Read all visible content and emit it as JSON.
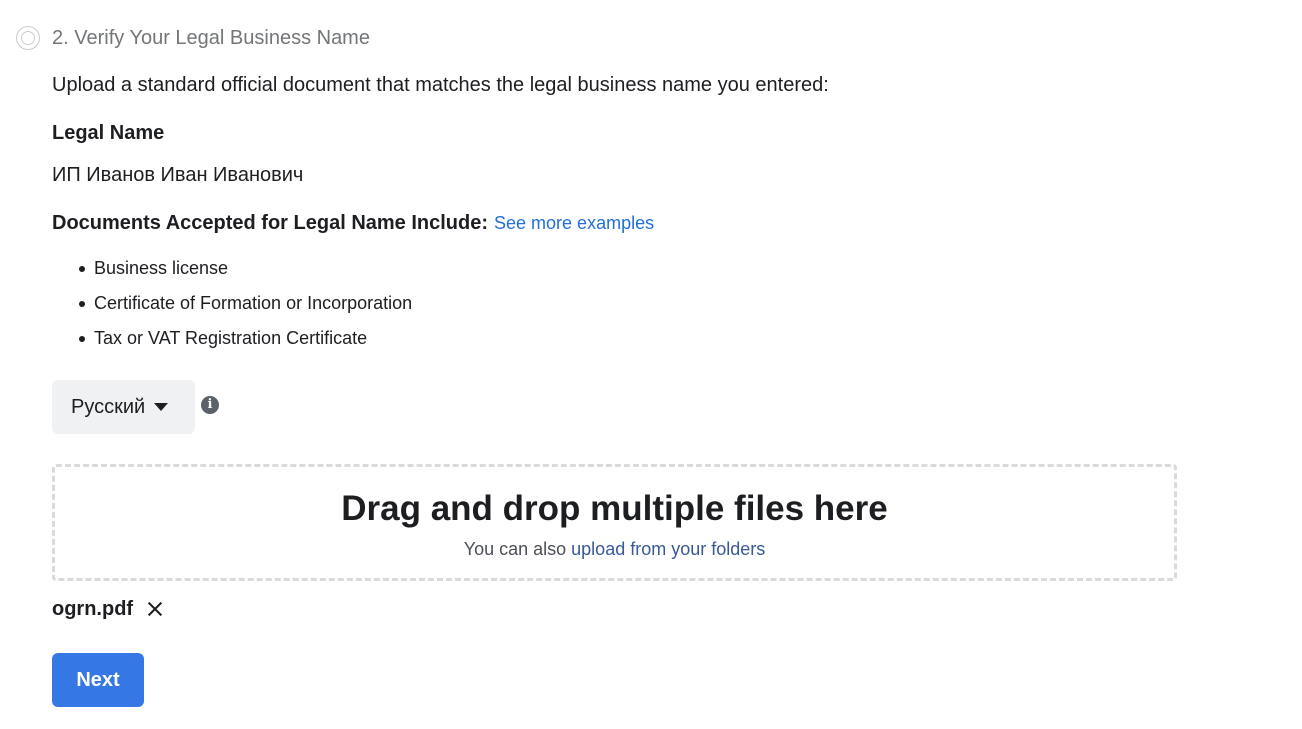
{
  "step": {
    "title": "2. Verify Your Legal Business Name"
  },
  "intro": "Upload a standard official document that matches the legal business name you entered:",
  "legal_name": {
    "label": "Legal Name",
    "value": "ИП Иванов Иван Иванович"
  },
  "documents": {
    "heading": "Documents Accepted for Legal Name Include:",
    "see_more_link": "See more examples",
    "items": [
      "Business license",
      "Certificate of Formation or Incorporation",
      "Tax or VAT Registration Certificate"
    ]
  },
  "language_select": {
    "selected": "Русский",
    "icon": "chevron-down-icon"
  },
  "info_icon": "info-icon",
  "dropzone": {
    "title": "Drag and drop multiple files here",
    "subtitle_prefix": "You can also",
    "upload_link": "upload from your folders"
  },
  "uploaded_file": {
    "name": "ogrn.pdf",
    "remove_icon": "close-icon"
  },
  "next_button": "Next",
  "colors": {
    "link": "#216fdb",
    "primary_button": "#3578e5",
    "dropzone_border": "#d9dadc"
  }
}
